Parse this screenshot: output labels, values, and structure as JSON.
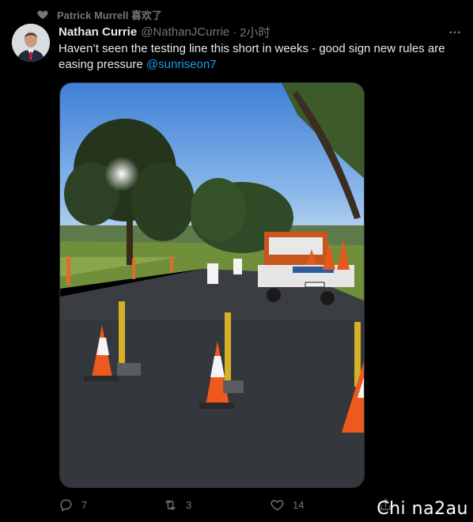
{
  "social_context": {
    "text": "Patrick Murrell 喜欢了"
  },
  "tweet": {
    "display_name": "Nathan Currie",
    "handle": "@NathanJCurrie",
    "separator": "·",
    "time": "2小时",
    "text": "Haven’t seen the testing line this short in weeks - good sign new rules are easing pressure ",
    "mention": "@sunriseon7"
  },
  "actions": {
    "reply_count": "7",
    "retweet_count": "3",
    "like_count": "14"
  },
  "watermark": "Chi na2au",
  "colors": {
    "background": "#000000",
    "text": "#e7e9ea",
    "muted": "#71767b",
    "link": "#1d9bf0"
  }
}
